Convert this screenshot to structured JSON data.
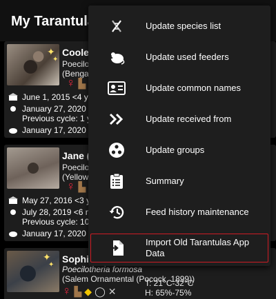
{
  "app_bar": {
    "title": "My Tarantulas"
  },
  "cards": [
    {
      "name": "Coolet",
      "species_line": "Poecilot",
      "common_line": "(Bengal",
      "acquired": "June 1, 2015 <4 yea",
      "last_molt": "January 27, 2020 <",
      "previous_cycle": "Previous cycle: 1 ye",
      "last_fed": "January 17, 2020 0"
    },
    {
      "name": "Jane (",
      "species_line": "Poecilot",
      "common_line": "(Yellow",
      "acquired": "May 27, 2016 <3 yea",
      "last_molt": "July 28, 2019 <6 mo",
      "previous_cycle": "Previous cycle: 10 m",
      "last_fed": "January 17, 2020 0"
    },
    {
      "name": "Sophie",
      "species_line": "Poecilotheria formosa",
      "common_line": "(Salem Ornamental (Pocock, 1899))",
      "temperature": "T: 21°C-32°C",
      "humidity": "H: 65%-75%"
    }
  ],
  "menu": {
    "items": [
      {
        "label": "Update species list",
        "icon": "dna-icon"
      },
      {
        "label": "Update used feeders",
        "icon": "mouse-icon"
      },
      {
        "label": "Update common names",
        "icon": "id-card-icon"
      },
      {
        "label": "Update received from",
        "icon": "double-chevron-right-icon"
      },
      {
        "label": "Update groups",
        "icon": "groups-icon"
      },
      {
        "label": "Summary",
        "icon": "clipboard-list-icon"
      },
      {
        "label": "Feed history maintenance",
        "icon": "history-icon"
      },
      {
        "label": "Import Old Tarantulas App Data",
        "icon": "import-icon"
      }
    ],
    "highlight_color": "#d01c24"
  },
  "colors": {
    "background": "#000000",
    "card": "#1d1d1d",
    "menu": "#1e1e1e",
    "female": "#e0273d"
  }
}
